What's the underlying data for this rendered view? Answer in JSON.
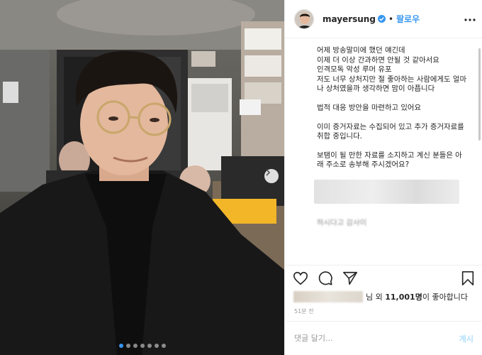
{
  "colors": {
    "link_blue": "#3897f0",
    "text": "#262626",
    "muted": "#999999",
    "post_disabled": "#b2dffc"
  },
  "header": {
    "username": "mayersung",
    "separator": "•",
    "follow_label": "팔로우",
    "more_icon": "more-horizontal-icon",
    "verified_icon": "verified-badge-icon"
  },
  "caption": {
    "paragraphs": [
      "어제 방송말미에 했던 얘긴데\n이제 더 이상 간과하면 안될 것 같아서요\n인격모독 악성 루머 유포\n저도 너무 상처지만 절 좋아하는 사람에게도 얼마나 상처였을까 생각하면 맘이 아픕니다",
      "법적 대응 방안을 마련하고 있어요",
      "이미 증거자료는 수집되어 있고 추가 증거자료를 취합 중입니다.",
      "보탬이 될 만한 자료를 소지하고 계신 분들은 아래 주소로 송부해 주시겠어요?"
    ],
    "cut_off_line": "하시다고 감사이"
  },
  "actions": {
    "like_icon": "heart-icon",
    "comment_icon": "comment-icon",
    "share_icon": "share-icon",
    "save_icon": "bookmark-icon"
  },
  "likes": {
    "prefix": "님 외",
    "count": "11,001명",
    "suffix": "이 좋아합니다"
  },
  "timestamp": "51분 전",
  "comment_input": {
    "placeholder": "댓글 달기...",
    "post_label": "게시"
  },
  "carousel": {
    "total": 7,
    "active_index": 0,
    "next_icon": "chevron-right-icon"
  }
}
